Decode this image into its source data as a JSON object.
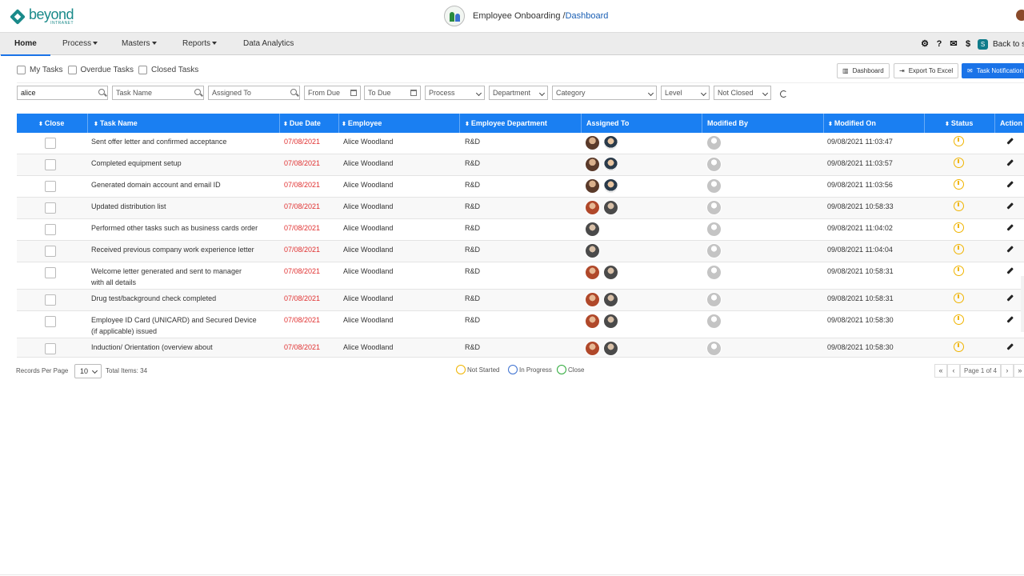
{
  "header": {
    "logo_main": "beyond",
    "logo_sub": "INTRANET",
    "app_title": "Employee Onboarding /",
    "app_title_link": "Dashboard"
  },
  "nav": {
    "items": [
      "Home",
      "Process",
      "Masters",
      "Reports",
      "Data Analytics"
    ],
    "back_label": "Back to s",
    "icons": [
      "gear-icon",
      "help-icon",
      "mail-icon",
      "dollar-icon",
      "sharepoint-icon"
    ]
  },
  "filters": {
    "checkboxes": [
      "My Tasks",
      "Overdue Tasks",
      "Closed Tasks"
    ],
    "buttons": {
      "dashboard": "Dashboard",
      "export": "Export To Excel",
      "notification": "Task Notification"
    },
    "employee_value": "alice",
    "task_name_placeholder": "Task Name",
    "assigned_to_placeholder": "Assigned To",
    "from_due_placeholder": "From Due",
    "to_due_placeholder": "To Due",
    "process": "Process",
    "department": "Department",
    "category": "Category",
    "level": "Level",
    "closed_state": "Not Closed"
  },
  "table": {
    "columns": [
      "Close",
      "Task Name",
      "Due Date",
      "Employee",
      "Employee Department",
      "Assigned To",
      "Modified By",
      "Modified On",
      "Status",
      "Action"
    ],
    "rows": [
      {
        "task": "Sent offer letter and confirmed acceptance",
        "task2": "",
        "due": "07/08/2021",
        "employee": "Alice Woodland",
        "dept": "R&D",
        "assigned": [
          "av-a",
          "av-b"
        ],
        "modified_on": "09/08/2021 11:03:47",
        "status": "Not Started"
      },
      {
        "task": "Completed equipment setup",
        "task2": "",
        "due": "07/08/2021",
        "employee": "Alice Woodland",
        "dept": "R&D",
        "assigned": [
          "av-a",
          "av-b"
        ],
        "modified_on": "09/08/2021 11:03:57",
        "status": "Not Started"
      },
      {
        "task": "Generated domain account and email ID",
        "task2": "",
        "due": "07/08/2021",
        "employee": "Alice Woodland",
        "dept": "R&D",
        "assigned": [
          "av-a",
          "av-b"
        ],
        "modified_on": "09/08/2021 11:03:56",
        "status": "Not Started"
      },
      {
        "task": "Updated distribution list",
        "task2": "",
        "due": "07/08/2021",
        "employee": "Alice Woodland",
        "dept": "R&D",
        "assigned": [
          "av-c",
          "av-d"
        ],
        "modified_on": "09/08/2021 10:58:33",
        "status": "Not Started"
      },
      {
        "task": "Performed other tasks such as business cards order",
        "task2": "",
        "due": "07/08/2021",
        "employee": "Alice Woodland",
        "dept": "R&D",
        "assigned": [
          "av-d"
        ],
        "modified_on": "09/08/2021 11:04:02",
        "status": "Not Started"
      },
      {
        "task": "Received previous company work experience letter",
        "task2": "",
        "due": "07/08/2021",
        "employee": "Alice Woodland",
        "dept": "R&D",
        "assigned": [
          "av-d"
        ],
        "modified_on": "09/08/2021 11:04:04",
        "status": "Not Started"
      },
      {
        "task": "Welcome letter generated and sent to manager",
        "task2": "with all details",
        "due": "07/08/2021",
        "employee": "Alice Woodland",
        "dept": "R&D",
        "assigned": [
          "av-c",
          "av-d"
        ],
        "modified_on": "09/08/2021 10:58:31",
        "status": "Not Started"
      },
      {
        "task": "Drug test/background check completed",
        "task2": "",
        "due": "07/08/2021",
        "employee": "Alice Woodland",
        "dept": "R&D",
        "assigned": [
          "av-c",
          "av-d"
        ],
        "modified_on": "09/08/2021 10:58:31",
        "status": "Not Started"
      },
      {
        "task": "Employee ID Card (UNICARD) and Secured Device",
        "task2": "(if applicable) issued",
        "due": "07/08/2021",
        "employee": "Alice Woodland",
        "dept": "R&D",
        "assigned": [
          "av-c",
          "av-d"
        ],
        "modified_on": "09/08/2021 10:58:30",
        "status": "Not Started"
      },
      {
        "task": "Induction/ Orientation (overview about",
        "task2": "",
        "due": "07/08/2021",
        "employee": "Alice Woodland",
        "dept": "R&D",
        "assigned": [
          "av-c",
          "av-d"
        ],
        "modified_on": "09/08/2021 10:58:30",
        "status": "Not Started"
      }
    ]
  },
  "footer": {
    "records_per_page_label": "Records Per Page",
    "records_per_page": "10",
    "total_items": "Total Items: 34",
    "legend": {
      "not_started": "Not Started",
      "in_progress": "In Progress",
      "close": "Close"
    },
    "page_info": "Page 1 of 4"
  },
  "colors": {
    "accent": "#1a7ff2",
    "due_date": "#e03030",
    "brand": "#1a8a8a",
    "status_not_started": "#f0b400"
  }
}
